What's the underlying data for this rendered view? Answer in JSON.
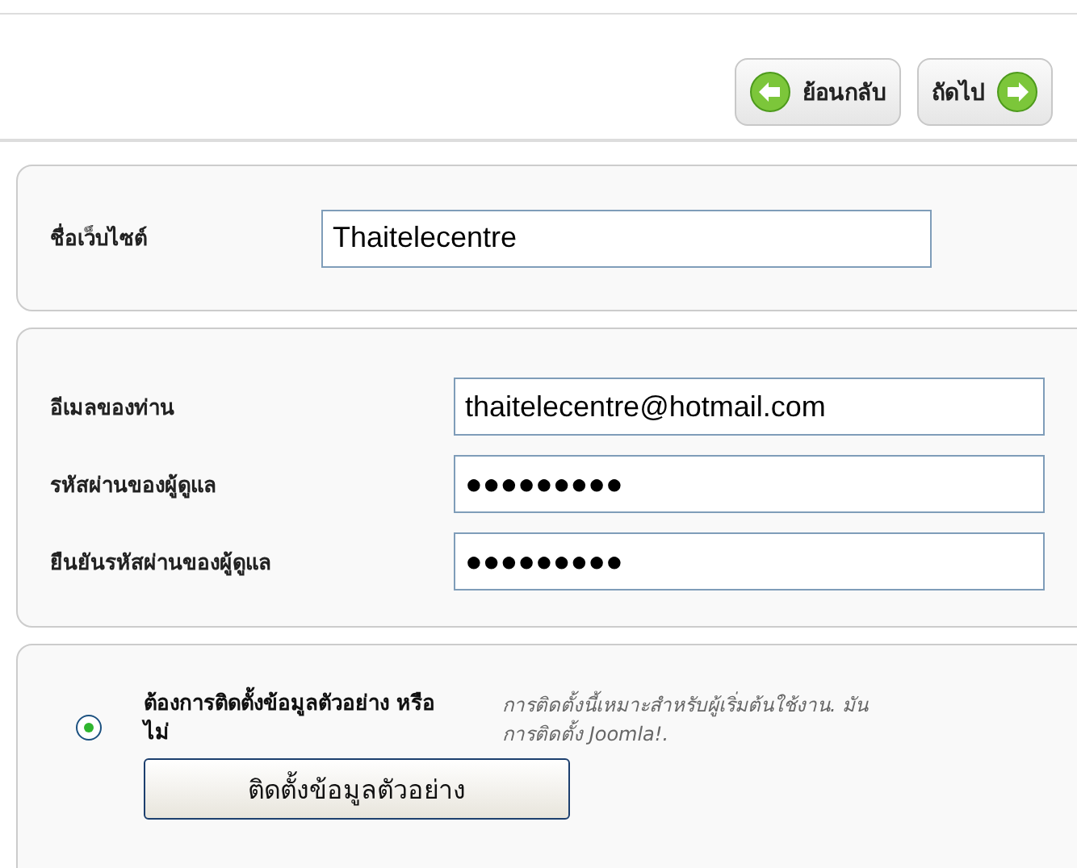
{
  "nav_buttons": [
    {
      "label": "ย้อนกลับ",
      "kind": "back"
    },
    {
      "label": "ถัดไป",
      "kind": "next"
    }
  ],
  "site_panel": {
    "fields": [
      {
        "label": "ชื่อเว็บไซต์",
        "value": "Thaitelecentre"
      }
    ]
  },
  "admin_panel": {
    "fields": [
      {
        "label": "อีเมลของท่าน",
        "value": "thaitelecentre@hotmail.com"
      },
      {
        "label": "รหัสผ่านของผู้ดูแล",
        "value": "●●●●●●●●●"
      },
      {
        "label": "ยืนยันรหัสผ่านของผู้ดูแล",
        "value": "●●●●●●●●●"
      }
    ]
  },
  "sample_panel": {
    "option": {
      "label": "ต้องการติดตั้งข้อมูลตัวอย่าง หรือไม่",
      "selected": true
    },
    "description": [
      "การติดตั้งนี้เหมาะสำหรับผู้เริ่มต้นใช้งาน. มัน",
      "การติดตั้ง Joomla!."
    ],
    "button": "ติดตั้งข้อมูลตัวอย่าง"
  }
}
